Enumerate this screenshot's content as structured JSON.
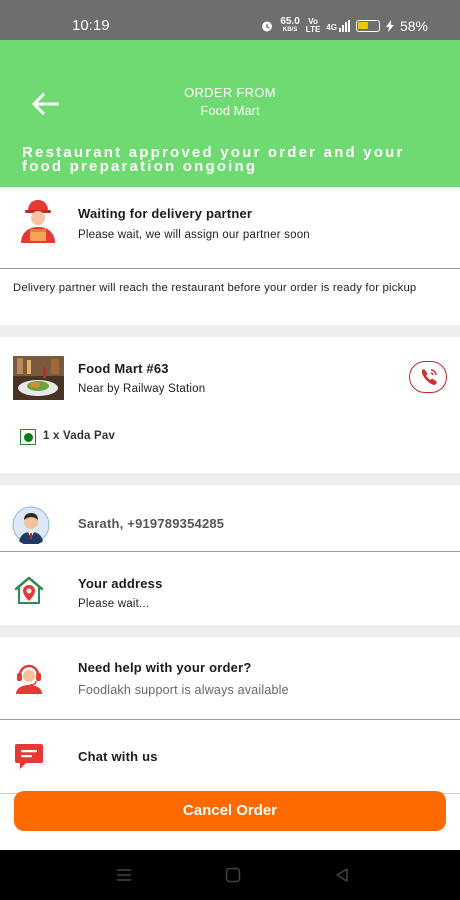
{
  "status_bar": {
    "time": "10:19",
    "net_speed_value": "65.0",
    "net_speed_unit": "KB/S",
    "volte": "Vo",
    "volte_sub": "LTE",
    "signal_type": "4G",
    "battery_percent": "58%",
    "battery_level": 0.58
  },
  "header": {
    "order_from_label": "ORDER FROM",
    "restaurant_name": "Food Mart",
    "status_message": "Restaurant approved your order and your food preparation ongoing",
    "bg_color": "#6fda71"
  },
  "delivery": {
    "title": "Waiting for delivery partner",
    "subtitle": "Please wait, we will assign our partner soon",
    "note": "Delivery partner will reach the restaurant before your order is ready for pickup"
  },
  "restaurant": {
    "name": "Food Mart #63",
    "location": "Near by Railway Station",
    "item": "1 x Vada Pav"
  },
  "customer": {
    "name_phone": "Sarath, +919789354285"
  },
  "address": {
    "title": "Your address",
    "subtitle": "Please wait..."
  },
  "help": {
    "title": "Need help with your order?",
    "subtitle": "Foodlakh support is always available"
  },
  "chat": {
    "label": "Chat with us"
  },
  "actions": {
    "cancel_label": "Cancel Order",
    "accent_color": "#ff6a00"
  }
}
